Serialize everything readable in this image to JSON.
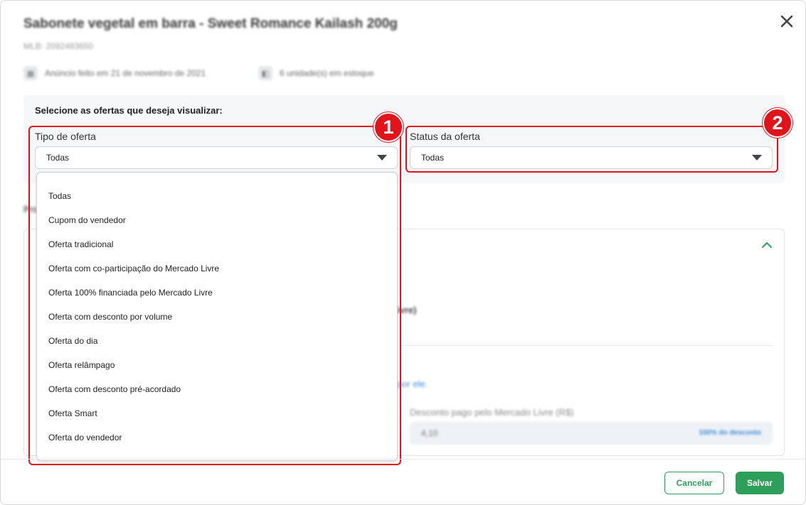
{
  "product": {
    "title": "Sabonete vegetal em barra - Sweet Romance Kailash 200g",
    "sku": "MLB: 2092483650",
    "listed": "Anúncio feito em 21 de novembro de 2021",
    "stock": "6 unidade(s) em estoque"
  },
  "filters": {
    "heading": "Selecione as ofertas que deseja visualizar:",
    "offer_type": {
      "label": "Tipo de oferta",
      "value": "Todas",
      "options": [
        "Todas",
        "Cupom do vendedor",
        "Oferta tradicional",
        "Oferta com co-participação do Mercado Livre",
        "Oferta 100% financiada pelo Mercado Livre",
        "Oferta com desconto por volume",
        "Oferta do dia",
        "Oferta relâmpago",
        "Oferta com desconto pré-acordado",
        "Oferta Smart",
        "Oferta do vendedor"
      ]
    },
    "offer_status": {
      "label": "Status da oferta",
      "value": "Todas"
    }
  },
  "callouts": [
    "1",
    "2"
  ],
  "background": {
    "section_label": "Pro",
    "fragment_1": "ivre)",
    "fragment_2": "por ele.",
    "discount_label": "Desconto pago pelo Mercado Livre (R$)",
    "discount_value": "4,10",
    "discount_hint": "100% do desconto"
  },
  "footer": {
    "cancel_label": "Cancelar",
    "save_label": "Salvar"
  },
  "colors": {
    "accent_green": "#2e9e5b",
    "callout_red": "#e1141c"
  }
}
